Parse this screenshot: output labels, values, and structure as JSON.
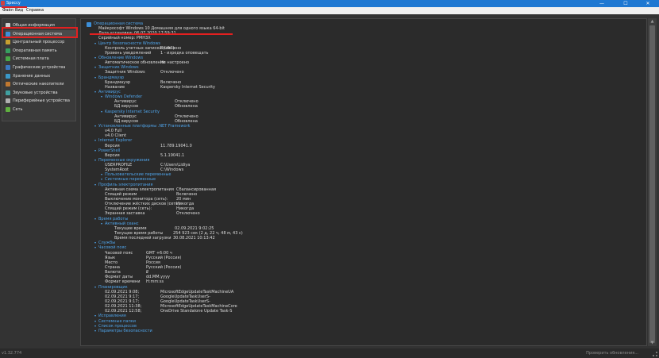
{
  "window": {
    "title": "Speccy",
    "minimize": "—",
    "maximize": "☐",
    "close": "✕"
  },
  "menu": {
    "file": "Файл",
    "view": "Вид",
    "help": "Справка"
  },
  "colors": {
    "accent": "#1e78d2",
    "section": "#4fa3e8",
    "highlight": "#e22020"
  },
  "sidebar": {
    "items": [
      {
        "label": "Общая информация",
        "icon": "summary-icon",
        "color": "#cfcfcf"
      },
      {
        "label": "Операционная система",
        "icon": "windows-icon",
        "color": "#3d8fd8"
      },
      {
        "label": "Центральный процессор",
        "icon": "cpu-icon",
        "color": "#c8a030"
      },
      {
        "label": "Оперативная память",
        "icon": "ram-icon",
        "color": "#37a060"
      },
      {
        "label": "Системная плата",
        "icon": "motherboard-icon",
        "color": "#48a848"
      },
      {
        "label": "Графические устройства",
        "icon": "gpu-icon",
        "color": "#3a78c0"
      },
      {
        "label": "Хранение данных",
        "icon": "storage-icon",
        "color": "#3a98c8"
      },
      {
        "label": "Оптические накопители",
        "icon": "optical-icon",
        "color": "#c07830"
      },
      {
        "label": "Звуковые устройства",
        "icon": "audio-icon",
        "color": "#40a0a0"
      },
      {
        "label": "Периферийные устройства",
        "icon": "peripheral-icon",
        "color": "#b0b0b0"
      },
      {
        "label": "Сеть",
        "icon": "network-icon",
        "color": "#60b040"
      }
    ]
  },
  "main": {
    "lines": [
      {
        "text": "Операционная система",
        "kind": "sec",
        "indent": 0
      },
      {
        "text": "Майкрософт Windows 10 Домашняя для одного языка 64-bit",
        "kind": "val",
        "indent": 1
      },
      {
        "text": "Дата установки: 06.07.2020 17:59:31",
        "kind": "val",
        "indent": 1
      },
      {
        "text": "Серийный номер: PMH3X",
        "kind": "val",
        "indent": 1
      },
      {
        "text": "Центр безопасности Windows",
        "kind": "sec",
        "indent": 1,
        "arrow": true
      },
      {
        "text": "Контроль учетных записей (UAC)",
        "value": "Включено",
        "kind": "val",
        "indent": 2
      },
      {
        "text": "Уровень уведомлений",
        "value": "1 - изредка оповещать",
        "kind": "val",
        "indent": 2
      },
      {
        "text": "Обновление Windows",
        "kind": "sec",
        "indent": 1,
        "arrow": true
      },
      {
        "text": "Автоматическое обновление",
        "value": "Не настроено",
        "kind": "val",
        "indent": 2
      },
      {
        "text": "Защитник Windows",
        "kind": "sec",
        "indent": 1,
        "arrow": true
      },
      {
        "text": "Защитник Windows",
        "value": "Отключено",
        "kind": "val",
        "indent": 2
      },
      {
        "text": "Брандмауэр",
        "kind": "sec",
        "indent": 1,
        "arrow": true
      },
      {
        "text": "Брандмауэр",
        "value": "Включено",
        "kind": "val",
        "indent": 2
      },
      {
        "text": "Название",
        "value": "Kaspersky Internet Security",
        "kind": "val",
        "indent": 2
      },
      {
        "text": "Антивирус",
        "kind": "sec",
        "indent": 1,
        "arrow": true
      },
      {
        "text": "Windows Defender",
        "kind": "sec",
        "indent": 2,
        "arrow": true
      },
      {
        "text": "Антивирус",
        "value": "Отключено",
        "kind": "val",
        "indent": 3
      },
      {
        "text": "БД вирусов",
        "value": "Обновлена",
        "kind": "val",
        "indent": 3
      },
      {
        "text": "Kaspersky Internet Security",
        "kind": "sec",
        "indent": 2,
        "arrow": true
      },
      {
        "text": "Антивирус",
        "value": "Отключено",
        "kind": "val",
        "indent": 3
      },
      {
        "text": "БД вирусов",
        "value": "Обновлена",
        "kind": "val",
        "indent": 3
      },
      {
        "text": "Установленные платформы .NET Framework",
        "kind": "sec",
        "indent": 1,
        "arrow": true
      },
      {
        "text": "v4.0 Full",
        "kind": "val",
        "indent": 2
      },
      {
        "text": "v4.0 Client",
        "kind": "val",
        "indent": 2
      },
      {
        "text": "Internet Explorer",
        "kind": "sec",
        "indent": 1,
        "arrow": true
      },
      {
        "text": "Версия",
        "value": "11.789.19041.0",
        "kind": "val",
        "indent": 2
      },
      {
        "text": "PowerShell",
        "kind": "sec",
        "indent": 1,
        "arrow": true
      },
      {
        "text": "Версия",
        "value": "5.1.19041.1",
        "kind": "val",
        "indent": 2
      },
      {
        "text": "Переменные окружения",
        "kind": "sec",
        "indent": 1,
        "arrow": true
      },
      {
        "text": "USERPROFILE",
        "value": "C:\\Users\\Lidiya",
        "kind": "val",
        "indent": 2
      },
      {
        "text": "SystemRoot",
        "value": "C:\\Windows",
        "kind": "val",
        "indent": 2
      },
      {
        "text": "Пользовательские переменные",
        "kind": "sec",
        "indent": 2,
        "arrow": true
      },
      {
        "text": "Системные переменные",
        "kind": "sec",
        "indent": 2,
        "arrow": true
      },
      {
        "text": "Профиль электропитания",
        "kind": "sec",
        "indent": 1,
        "arrow": true
      },
      {
        "text": "Активная схема электропитания",
        "value": "Сбалансированная",
        "kind": "val",
        "indent": 2
      },
      {
        "text": "Спящий режим",
        "value": "Включено",
        "kind": "val",
        "indent": 2
      },
      {
        "text": "Выключение монитора (сеть):",
        "value": "20 мин",
        "kind": "val",
        "indent": 2
      },
      {
        "text": "Отключение жёстких дисков (сеть):",
        "value": "Никогда",
        "kind": "val",
        "indent": 2
      },
      {
        "text": "Спящий режим (сеть):",
        "value": "Никогда",
        "kind": "val",
        "indent": 2
      },
      {
        "text": "Экранная заставка",
        "value": "Отключено",
        "kind": "val",
        "indent": 2
      },
      {
        "text": "Время работы",
        "kind": "sec",
        "indent": 1,
        "arrow": true
      },
      {
        "text": "Активный сеанс",
        "kind": "sec",
        "indent": 2,
        "arrow": true
      },
      {
        "text": "Текущее время",
        "value": "02.09.2021 9:02:25",
        "kind": "val",
        "indent": 3
      },
      {
        "text": "Текущее время работы",
        "value": "254 923 сек (2 д, 22 ч, 48 м, 43 с)",
        "kind": "val",
        "indent": 3
      },
      {
        "text": "Время последней загрузки",
        "value": "30.08.2021 10:13:42",
        "kind": "val",
        "indent": 3
      },
      {
        "text": "Службы",
        "kind": "sec",
        "indent": 1,
        "arrow": true
      },
      {
        "text": "Часовой пояс",
        "kind": "sec",
        "indent": 1,
        "arrow": true
      },
      {
        "text": "Часовой пояс",
        "value": "GMT +6:00 ч",
        "kind": "val",
        "indent": 2
      },
      {
        "text": "Язык",
        "value": "Русский (Россия)",
        "kind": "val",
        "indent": 2
      },
      {
        "text": "Место",
        "value": "Россия",
        "kind": "val",
        "indent": 2
      },
      {
        "text": "Страна",
        "value": "Русский (Россия)",
        "kind": "val",
        "indent": 2
      },
      {
        "text": "Валюта",
        "value": "₽",
        "kind": "val",
        "indent": 2
      },
      {
        "text": "Формат даты",
        "value": "dd.MM.yyyy",
        "kind": "val",
        "indent": 2
      },
      {
        "text": "Формат времени",
        "value": "H:mm:ss",
        "kind": "val",
        "indent": 2
      },
      {
        "text": "Планировщик",
        "kind": "sec",
        "indent": 1,
        "arrow": true
      },
      {
        "text": "02.09.2021 9:08;",
        "value": "MicrosoftEdgeUpdateTaskMachineUA",
        "kind": "val",
        "indent": 2
      },
      {
        "text": "02.09.2021 9:17;",
        "value": "GoogleUpdateTaskUserS-",
        "kind": "val",
        "indent": 2
      },
      {
        "text": "02.09.2021 9:17;",
        "value": "GoogleUpdateTaskUserS-",
        "kind": "val",
        "indent": 2
      },
      {
        "text": "02.09.2021 11:38;",
        "value": "MicrosoftEdgeUpdateTaskMachineCore",
        "kind": "val",
        "indent": 2
      },
      {
        "text": "02.09.2021 12:58;",
        "value": "OneDrive Standalone Update Task-S",
        "kind": "val",
        "indent": 2
      },
      {
        "text": "Исправления",
        "kind": "sec",
        "indent": 1,
        "arrow": true
      },
      {
        "text": "Системные папки",
        "kind": "sec",
        "indent": 1,
        "arrow": true
      },
      {
        "text": "Список процессов",
        "kind": "sec",
        "indent": 1,
        "arrow": true
      },
      {
        "text": "Параметры безопасности",
        "kind": "sec",
        "indent": 1,
        "arrow": true
      }
    ]
  },
  "status": {
    "version": "v1.32.774",
    "check_updates": "Проверить обновления..."
  }
}
